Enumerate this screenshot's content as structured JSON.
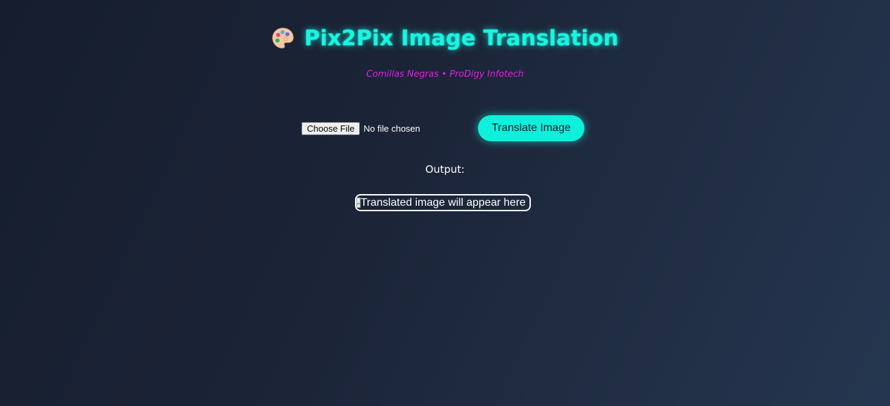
{
  "header": {
    "icon": "palette-icon",
    "title": "Pix2Pix Image Translation",
    "subtitle": "Comillas Negras • ProDigy Infotech"
  },
  "upload": {
    "choose_file_label": "Choose File",
    "file_status": "No file chosen"
  },
  "actions": {
    "translate_label": "Translate Image"
  },
  "output": {
    "label": "Output:",
    "image_alt": "Translated image will appear here",
    "broken_icon": "broken-image-icon"
  },
  "colors": {
    "accent": "#0ef0dc",
    "subtitle": "#e01ee6",
    "background_start": "#151d2e",
    "background_end": "#253650"
  }
}
